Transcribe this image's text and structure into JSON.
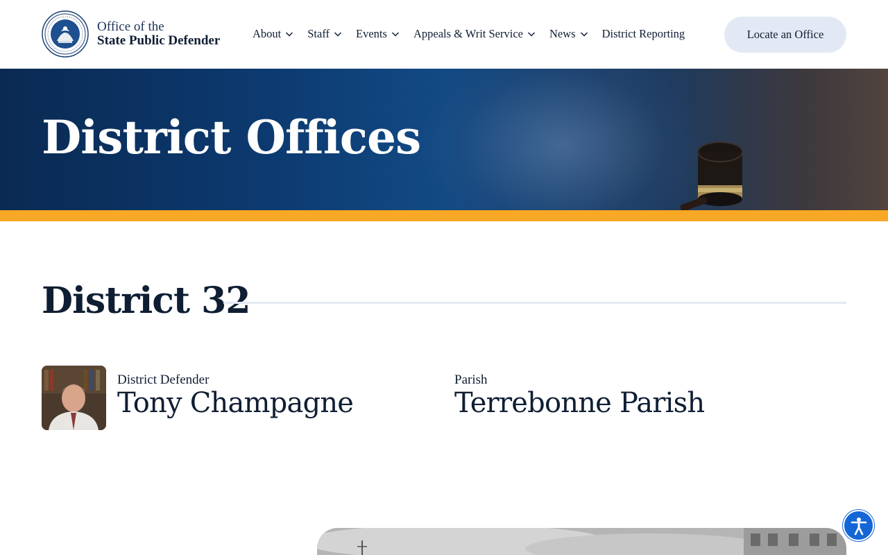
{
  "header": {
    "brand_line1": "Office of the",
    "brand_line2": "State Public Defender",
    "logo_icon": "state-of-louisiana-seal",
    "nav": [
      {
        "label": "About",
        "has_dropdown": true
      },
      {
        "label": "Staff",
        "has_dropdown": true
      },
      {
        "label": "Events",
        "has_dropdown": true
      },
      {
        "label": "Appeals & Writ Service",
        "has_dropdown": true
      },
      {
        "label": "News",
        "has_dropdown": true
      },
      {
        "label": "District Reporting",
        "has_dropdown": false
      }
    ],
    "cta_label": "Locate an Office"
  },
  "hero": {
    "title": "District Offices",
    "accent_color": "#f8a824"
  },
  "district": {
    "title": "District 32",
    "defender_label": "District Defender",
    "defender_name": "Tony Champagne",
    "parish_label": "Parish",
    "parish_name": "Terrebonne Parish"
  },
  "accessibility": {
    "icon": "accessibility-icon",
    "color": "#1466d6"
  },
  "colors": {
    "navy": "#0f1e33",
    "button_bg": "#e3e9f4",
    "hero_blue": "#0c3a70"
  }
}
